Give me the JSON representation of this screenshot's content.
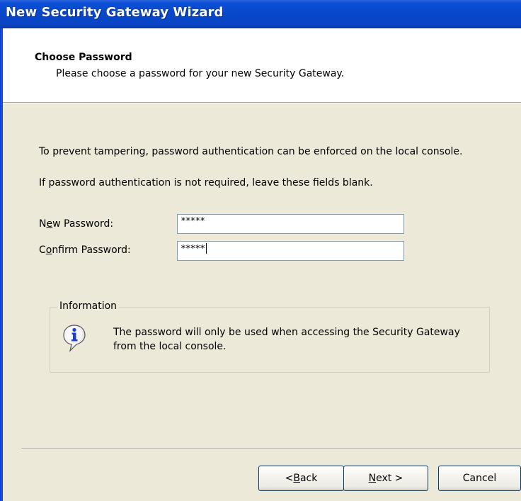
{
  "window": {
    "title": "New Security Gateway Wizard"
  },
  "header": {
    "title": "Choose Password",
    "subtitle": "Please choose a password for your new Security Gateway."
  },
  "body": {
    "paragraph1": "To prevent tampering, password authentication can be enforced on the local console.",
    "paragraph2": "If password authentication is not required, leave these fields blank."
  },
  "form": {
    "new_password": {
      "label_pre": "N",
      "label_access": "e",
      "label_post": "w Password:",
      "value": "*****"
    },
    "confirm_password": {
      "label_pre": "C",
      "label_access": "o",
      "label_post": "nfirm Password:",
      "value": "*****"
    }
  },
  "info_group": {
    "legend": "Information",
    "icon": "info-icon",
    "line1": "The password will only be used when accessing the Security Gateway",
    "line2": "from the local console."
  },
  "buttons": {
    "back": {
      "pre": "< ",
      "access": "B",
      "post": "ack"
    },
    "next": {
      "pre": "",
      "access": "N",
      "post": "ext >"
    },
    "cancel": "Cancel"
  },
  "colors": {
    "titlebar": "#0a4fd6",
    "dialog_bg": "#ece9d8",
    "header_bg": "#ffffff",
    "info_icon_blue": "#1c3fcf"
  }
}
